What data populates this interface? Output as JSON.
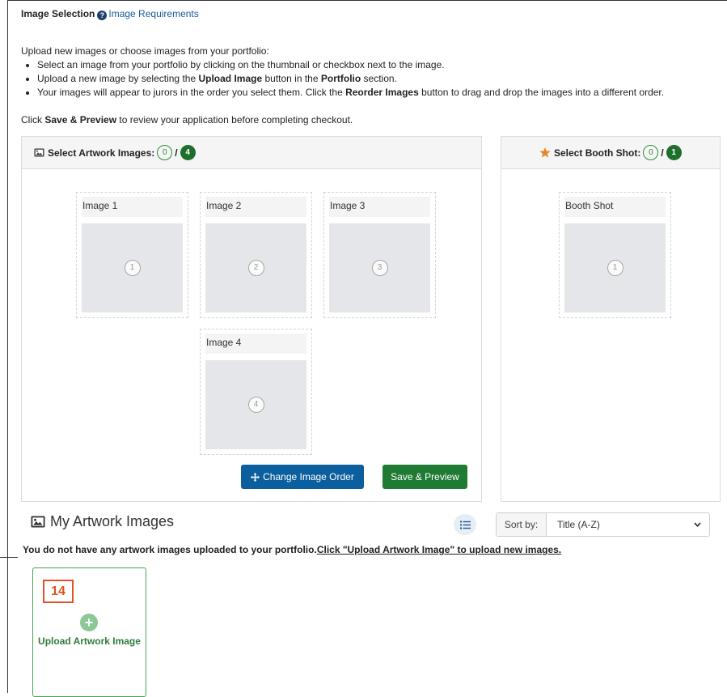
{
  "header": {
    "title": "Image Selection",
    "help_icon": "question-circle-icon",
    "requirements_link": "Image Requirements"
  },
  "intro": {
    "lead": "Upload new images or choose images from your portfolio:",
    "bullet1": "Select an image from your portfolio by clicking on the thumbnail or checkbox next to the image.",
    "bullet2_pre": "Upload a new image by selecting the ",
    "bullet2_bold1": "Upload Image",
    "bullet2_mid": " button in the ",
    "bullet2_bold2": "Portfolio",
    "bullet2_post": " section.",
    "bullet3_pre": "Your images will appear to jurors in the order you select them. Click the ",
    "bullet3_bold": "Reorder Images",
    "bullet3_post": " button to drag and drop the images into a different order."
  },
  "preview_note": {
    "pre": "Click ",
    "bold": "Save & Preview",
    "post": " to review your application before completing checkout."
  },
  "artwork_panel": {
    "title": "Select Artwork Images:",
    "selected": "0",
    "separator": "/",
    "max": "4",
    "slots": [
      {
        "label": "Image 1",
        "number": "1"
      },
      {
        "label": "Image 2",
        "number": "2"
      },
      {
        "label": "Image 3",
        "number": "3"
      },
      {
        "label": "Image 4",
        "number": "4"
      }
    ],
    "change_order_button": "Change Image Order",
    "save_preview_button": "Save & Preview"
  },
  "booth_panel": {
    "title": "Select Booth Shot:",
    "selected": "0",
    "separator": "/",
    "max": "1",
    "slot": {
      "label": "Booth Shot",
      "number": "1"
    }
  },
  "my_artwork": {
    "title": "My Artwork Images",
    "sort_label": "Sort by:",
    "sort_value": "Title (A-Z)",
    "empty_message": "You do not have any artwork images uploaded to your portfolio.",
    "empty_link": "Click \"Upload Artwork Image\" to upload new images.",
    "step_badge": "14",
    "upload_label": "Upload Artwork Image"
  },
  "colors": {
    "primary_blue": "#0b5f9e",
    "primary_green": "#1f7a34",
    "star_orange": "#e8862a",
    "badge_orange": "#e0532a"
  }
}
